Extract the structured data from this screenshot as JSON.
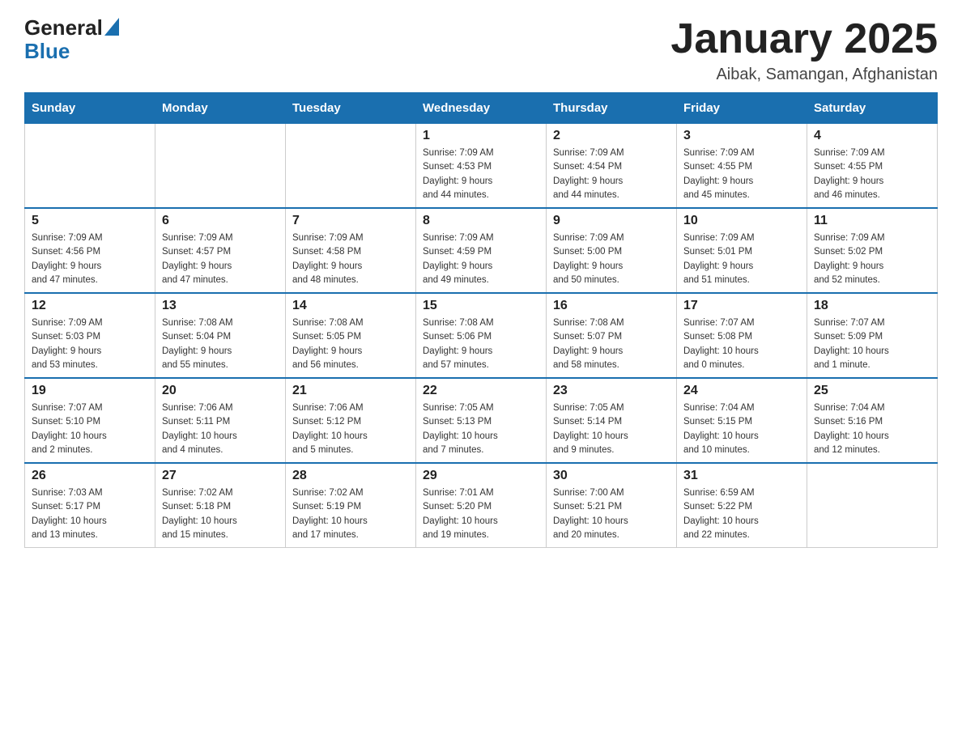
{
  "logo": {
    "text_general": "General",
    "text_blue": "Blue",
    "arrow": "▲"
  },
  "title": "January 2025",
  "subtitle": "Aibak, Samangan, Afghanistan",
  "headers": [
    "Sunday",
    "Monday",
    "Tuesday",
    "Wednesday",
    "Thursday",
    "Friday",
    "Saturday"
  ],
  "weeks": [
    [
      {
        "day": "",
        "info": ""
      },
      {
        "day": "",
        "info": ""
      },
      {
        "day": "",
        "info": ""
      },
      {
        "day": "1",
        "info": "Sunrise: 7:09 AM\nSunset: 4:53 PM\nDaylight: 9 hours\nand 44 minutes."
      },
      {
        "day": "2",
        "info": "Sunrise: 7:09 AM\nSunset: 4:54 PM\nDaylight: 9 hours\nand 44 minutes."
      },
      {
        "day": "3",
        "info": "Sunrise: 7:09 AM\nSunset: 4:55 PM\nDaylight: 9 hours\nand 45 minutes."
      },
      {
        "day": "4",
        "info": "Sunrise: 7:09 AM\nSunset: 4:55 PM\nDaylight: 9 hours\nand 46 minutes."
      }
    ],
    [
      {
        "day": "5",
        "info": "Sunrise: 7:09 AM\nSunset: 4:56 PM\nDaylight: 9 hours\nand 47 minutes."
      },
      {
        "day": "6",
        "info": "Sunrise: 7:09 AM\nSunset: 4:57 PM\nDaylight: 9 hours\nand 47 minutes."
      },
      {
        "day": "7",
        "info": "Sunrise: 7:09 AM\nSunset: 4:58 PM\nDaylight: 9 hours\nand 48 minutes."
      },
      {
        "day": "8",
        "info": "Sunrise: 7:09 AM\nSunset: 4:59 PM\nDaylight: 9 hours\nand 49 minutes."
      },
      {
        "day": "9",
        "info": "Sunrise: 7:09 AM\nSunset: 5:00 PM\nDaylight: 9 hours\nand 50 minutes."
      },
      {
        "day": "10",
        "info": "Sunrise: 7:09 AM\nSunset: 5:01 PM\nDaylight: 9 hours\nand 51 minutes."
      },
      {
        "day": "11",
        "info": "Sunrise: 7:09 AM\nSunset: 5:02 PM\nDaylight: 9 hours\nand 52 minutes."
      }
    ],
    [
      {
        "day": "12",
        "info": "Sunrise: 7:09 AM\nSunset: 5:03 PM\nDaylight: 9 hours\nand 53 minutes."
      },
      {
        "day": "13",
        "info": "Sunrise: 7:08 AM\nSunset: 5:04 PM\nDaylight: 9 hours\nand 55 minutes."
      },
      {
        "day": "14",
        "info": "Sunrise: 7:08 AM\nSunset: 5:05 PM\nDaylight: 9 hours\nand 56 minutes."
      },
      {
        "day": "15",
        "info": "Sunrise: 7:08 AM\nSunset: 5:06 PM\nDaylight: 9 hours\nand 57 minutes."
      },
      {
        "day": "16",
        "info": "Sunrise: 7:08 AM\nSunset: 5:07 PM\nDaylight: 9 hours\nand 58 minutes."
      },
      {
        "day": "17",
        "info": "Sunrise: 7:07 AM\nSunset: 5:08 PM\nDaylight: 10 hours\nand 0 minutes."
      },
      {
        "day": "18",
        "info": "Sunrise: 7:07 AM\nSunset: 5:09 PM\nDaylight: 10 hours\nand 1 minute."
      }
    ],
    [
      {
        "day": "19",
        "info": "Sunrise: 7:07 AM\nSunset: 5:10 PM\nDaylight: 10 hours\nand 2 minutes."
      },
      {
        "day": "20",
        "info": "Sunrise: 7:06 AM\nSunset: 5:11 PM\nDaylight: 10 hours\nand 4 minutes."
      },
      {
        "day": "21",
        "info": "Sunrise: 7:06 AM\nSunset: 5:12 PM\nDaylight: 10 hours\nand 5 minutes."
      },
      {
        "day": "22",
        "info": "Sunrise: 7:05 AM\nSunset: 5:13 PM\nDaylight: 10 hours\nand 7 minutes."
      },
      {
        "day": "23",
        "info": "Sunrise: 7:05 AM\nSunset: 5:14 PM\nDaylight: 10 hours\nand 9 minutes."
      },
      {
        "day": "24",
        "info": "Sunrise: 7:04 AM\nSunset: 5:15 PM\nDaylight: 10 hours\nand 10 minutes."
      },
      {
        "day": "25",
        "info": "Sunrise: 7:04 AM\nSunset: 5:16 PM\nDaylight: 10 hours\nand 12 minutes."
      }
    ],
    [
      {
        "day": "26",
        "info": "Sunrise: 7:03 AM\nSunset: 5:17 PM\nDaylight: 10 hours\nand 13 minutes."
      },
      {
        "day": "27",
        "info": "Sunrise: 7:02 AM\nSunset: 5:18 PM\nDaylight: 10 hours\nand 15 minutes."
      },
      {
        "day": "28",
        "info": "Sunrise: 7:02 AM\nSunset: 5:19 PM\nDaylight: 10 hours\nand 17 minutes."
      },
      {
        "day": "29",
        "info": "Sunrise: 7:01 AM\nSunset: 5:20 PM\nDaylight: 10 hours\nand 19 minutes."
      },
      {
        "day": "30",
        "info": "Sunrise: 7:00 AM\nSunset: 5:21 PM\nDaylight: 10 hours\nand 20 minutes."
      },
      {
        "day": "31",
        "info": "Sunrise: 6:59 AM\nSunset: 5:22 PM\nDaylight: 10 hours\nand 22 minutes."
      },
      {
        "day": "",
        "info": ""
      }
    ]
  ]
}
